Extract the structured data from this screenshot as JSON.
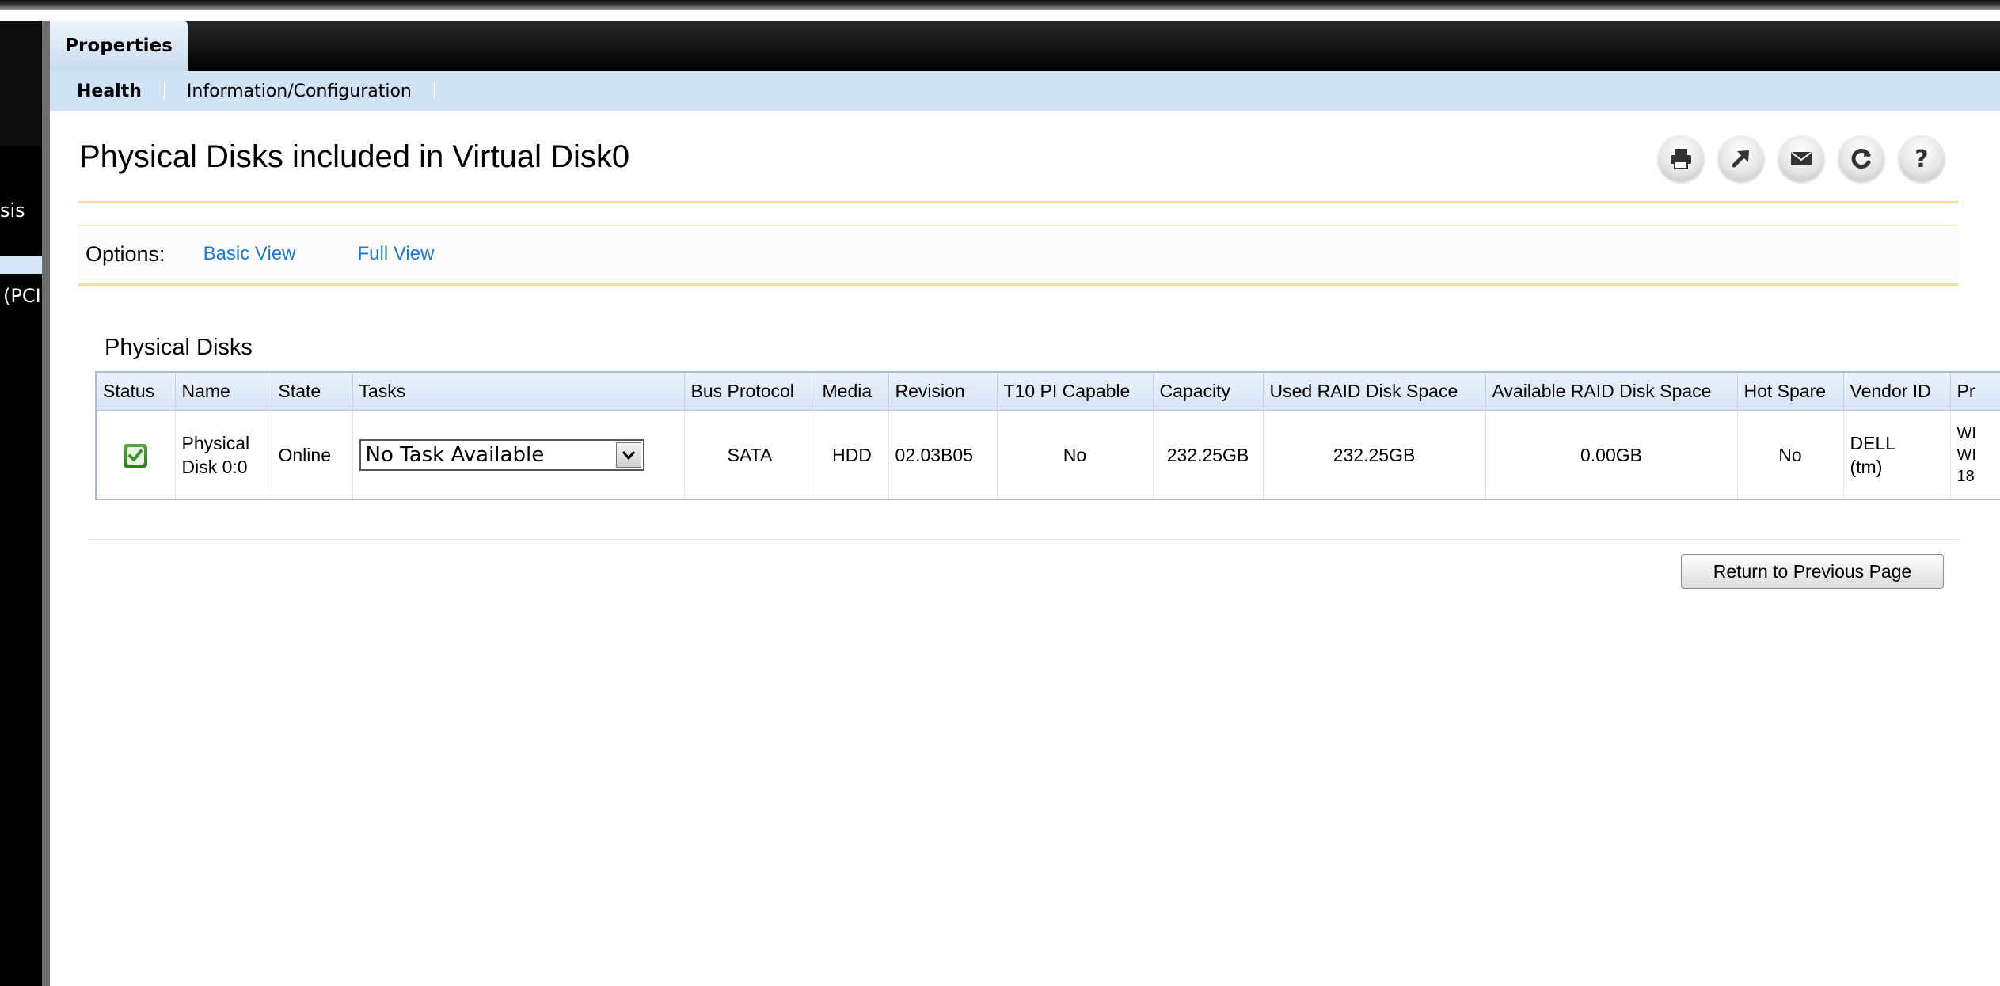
{
  "sidebar": {
    "items": [
      {
        "label": "sis"
      },
      {
        "label": "(PCI"
      }
    ]
  },
  "tabs": {
    "active": "Properties"
  },
  "subnav": {
    "items": [
      {
        "label": "Health",
        "active": true
      },
      {
        "label": "Information/Configuration",
        "active": false
      }
    ]
  },
  "page": {
    "title": "Physical Disks included in Virtual Disk0"
  },
  "toolbar": {
    "icons": [
      "print-icon",
      "export-icon",
      "email-icon",
      "refresh-icon",
      "help-icon"
    ]
  },
  "options": {
    "label": "Options:",
    "basic_view": "Basic View",
    "full_view": "Full View"
  },
  "section": {
    "title": "Physical Disks"
  },
  "table": {
    "headers": [
      "Status",
      "Name",
      "State",
      "Tasks",
      "Bus Protocol",
      "Media",
      "Revision",
      "T10 PI Capable",
      "Capacity",
      "Used RAID Disk Space",
      "Available RAID Disk Space",
      "Hot Spare",
      "Vendor ID",
      "Pr"
    ],
    "row": {
      "status": "ok",
      "name_line1": "Physical",
      "name_line2": "Disk 0:0",
      "state": "Online",
      "task": "No Task Available",
      "bus_protocol": "SATA",
      "media": "HDD",
      "revision": "02.03B05",
      "t10": "No",
      "capacity": "232.25GB",
      "used": "232.25GB",
      "available": "0.00GB",
      "hot_spare": "No",
      "vendor_line1": "DELL",
      "vendor_line2": "(tm)",
      "pr_line1": "WI",
      "pr_line2": "WI",
      "pr_line3": "18"
    }
  },
  "buttons": {
    "return": "Return to Previous Page"
  },
  "colors": {
    "tab_bar": "#000000",
    "subnav_bg": "#cfe2f6",
    "link": "#1b7bd0",
    "rule": "#f0dda5",
    "status_ok": "#3f8f30"
  }
}
